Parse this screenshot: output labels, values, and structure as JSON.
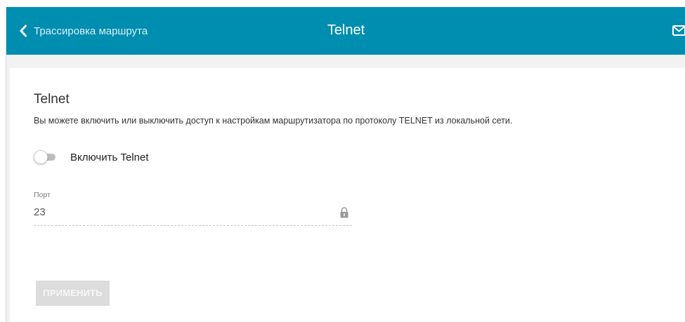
{
  "header": {
    "back_label": "Трассировка маршрута",
    "title": "Telnet",
    "icons": {
      "back": "chevron-left-icon",
      "mail": "mail-icon"
    },
    "background_color": "#008eb0"
  },
  "section": {
    "title": "Telnet",
    "description": "Вы можете включить или выключить доступ к настройкам маршрутизатора по протоколу TELNET из локальной сети."
  },
  "toggle": {
    "label": "Включить Telnet",
    "state": "off"
  },
  "port_field": {
    "label": "Порт",
    "value": "23",
    "icon": "lock-icon",
    "locked": true
  },
  "apply_button": {
    "label": "ПРИМЕНИТЬ",
    "disabled": true
  }
}
